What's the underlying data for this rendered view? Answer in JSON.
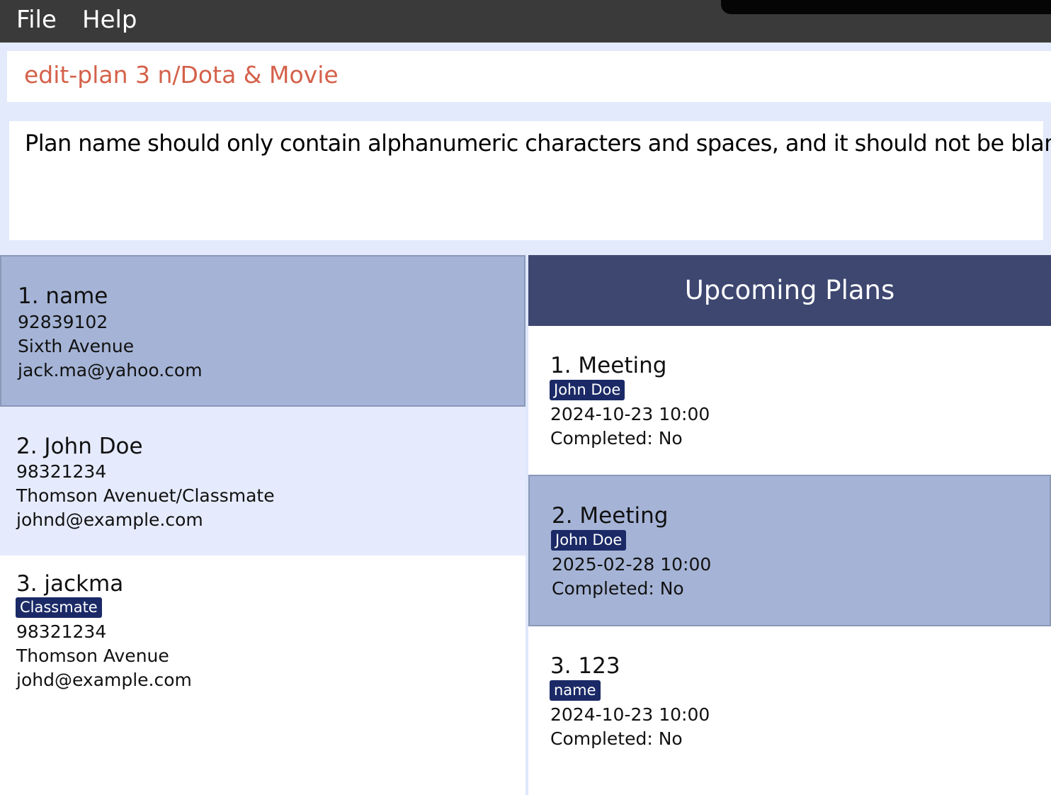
{
  "menu": {
    "file": "File",
    "help": "Help"
  },
  "command": {
    "value": "edit-plan 3 n/Dota & Movie"
  },
  "result": {
    "message": "Plan name should only contain alphanumeric characters and spaces, and it should not be blank"
  },
  "persons": [
    {
      "title": "1.  name",
      "tags": [],
      "phone": "92839102",
      "address": "Sixth Avenue",
      "email": "jack.ma@yahoo.com",
      "selected": true
    },
    {
      "title": "2.  John Doe",
      "tags": [],
      "phone": "98321234",
      "address": "Thomson Avenuet/Classmate",
      "email": "johnd@example.com",
      "selected": false
    },
    {
      "title": "3.  jackma",
      "tags": [
        "Classmate"
      ],
      "phone": "98321234",
      "address": "Thomson Avenue",
      "email": "johd@example.com",
      "selected": false
    }
  ],
  "plans": {
    "header": "Upcoming Plans",
    "items": [
      {
        "title": "1.  Meeting",
        "tag": "John Doe",
        "datetime": "2024-10-23 10:00",
        "completed": "Completed: No",
        "selected": false
      },
      {
        "title": "2.  Meeting",
        "tag": "John Doe",
        "datetime": "2025-02-28 10:00",
        "completed": "Completed: No",
        "selected": true
      },
      {
        "title": "3.  123",
        "tag": "name",
        "datetime": "2024-10-23 10:00",
        "completed": "Completed: No",
        "selected": false
      }
    ]
  },
  "colors": {
    "menubar": "#3a3a3a",
    "command_text": "#d4614a",
    "selected_card": "#a5b4d6",
    "alt_card": "#e5ebfd",
    "tag_bg": "#1b2a66",
    "plan_header": "#3d4770"
  }
}
